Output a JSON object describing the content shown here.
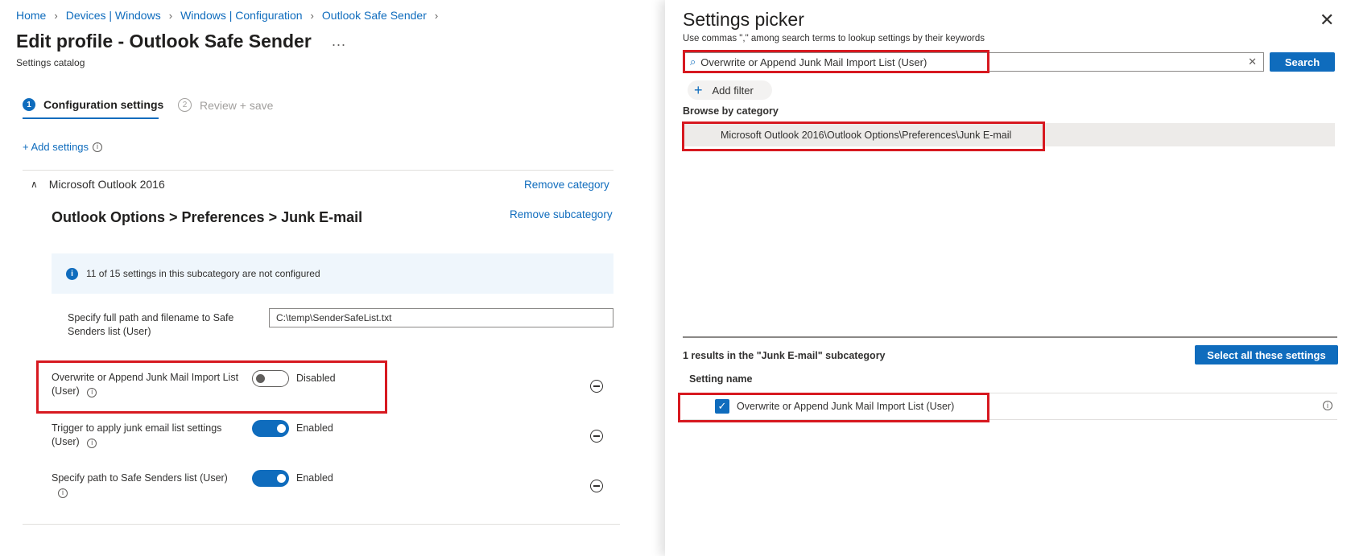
{
  "breadcrumb": [
    "Home",
    "Devices | Windows",
    "Windows | Configuration",
    "Outlook Safe Sender"
  ],
  "page": {
    "title": "Edit profile - Outlook Safe Sender",
    "more": "...",
    "subtitle": "Settings catalog"
  },
  "steps": [
    {
      "number": "1",
      "label": "Configuration settings"
    },
    {
      "number": "2",
      "label": "Review + save"
    }
  ],
  "add_settings": "+ Add settings",
  "category": {
    "name": "Microsoft Outlook 2016",
    "remove_label": "Remove category",
    "subcategory": "Outlook Options > Preferences > Junk E-mail",
    "remove_sub_label": "Remove subcategory",
    "info": "11 of 15 settings in this subcategory are not configured"
  },
  "settings": [
    {
      "label": "Specify full path and filename to Safe Senders list (User)",
      "value": "C:\\temp\\SenderSafeList.txt"
    },
    {
      "label": "Overwrite or Append Junk Mail Import List (User)",
      "state": "Disabled"
    },
    {
      "label": "Trigger to apply junk email list settings (User)",
      "state": "Enabled"
    },
    {
      "label": "Specify path to Safe Senders list (User)",
      "state": "Enabled"
    }
  ],
  "picker": {
    "title": "Settings picker",
    "hint": "Use commas \",\" among search terms to lookup settings by their keywords",
    "search_value": "Overwrite or Append Junk Mail Import List (User)",
    "search_button": "Search",
    "add_filter": "Add filter",
    "browse_label": "Browse by category",
    "category_item": "Microsoft Outlook 2016\\Outlook Options\\Preferences\\Junk E-mail",
    "results_text": "1 results in the \"Junk E-mail\" subcategory",
    "select_all": "Select all these settings",
    "column_header": "Setting name",
    "result_item": "Overwrite or Append Junk Mail Import List (User)"
  },
  "colors": {
    "accent": "#0f6cbd",
    "highlight_box": "#d71920",
    "info_bg": "#eff6fc"
  },
  "icons": [
    "chevron-right-icon",
    "chevron-up-icon",
    "info-icon",
    "minus-circle-icon",
    "search-icon",
    "clear-icon",
    "plus-icon",
    "close-icon",
    "checkmark-icon"
  ]
}
